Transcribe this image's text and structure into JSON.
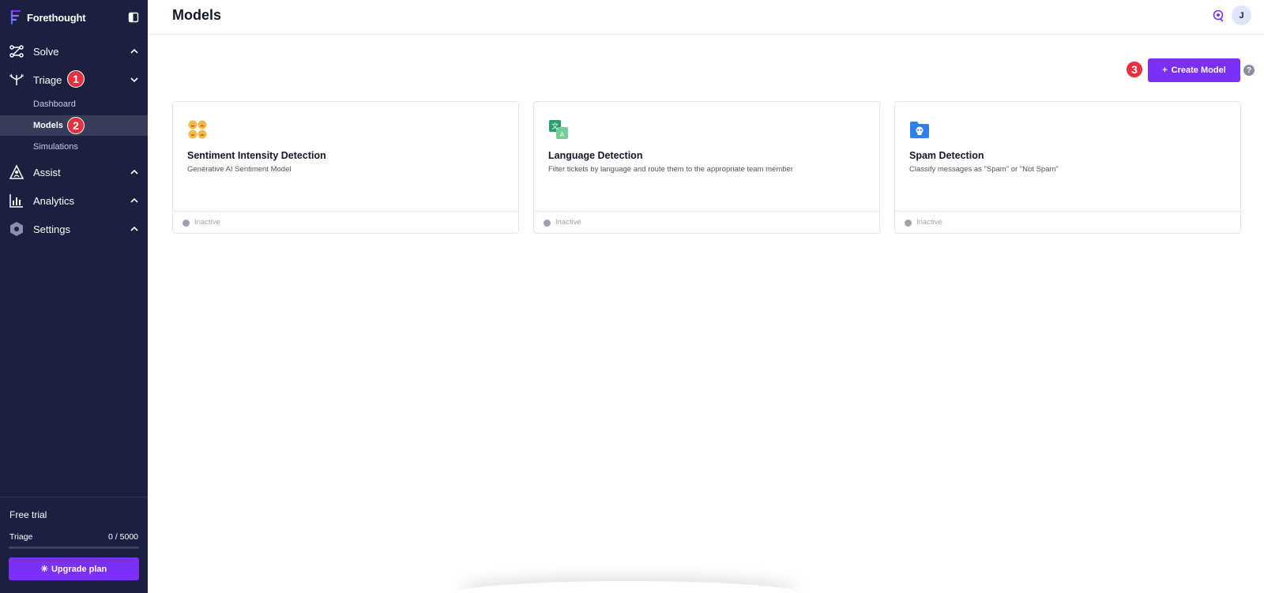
{
  "app": {
    "brand": "Forethought"
  },
  "sidebar": {
    "nav": [
      {
        "label": "Solve"
      },
      {
        "label": "Triage"
      },
      {
        "label": "Assist"
      },
      {
        "label": "Analytics"
      },
      {
        "label": "Settings"
      }
    ],
    "triage_sub": [
      {
        "label": "Dashboard"
      },
      {
        "label": "Models"
      },
      {
        "label": "Simulations"
      }
    ],
    "trial": {
      "title": "Free trial",
      "usage_label": "Triage",
      "usage_value": "0 / 5000",
      "usage_fraction": 0,
      "upgrade_label": "Upgrade plan"
    }
  },
  "markers": [
    "1",
    "2",
    "3"
  ],
  "header": {
    "title": "Models",
    "avatar_initial": "J"
  },
  "actions": {
    "create_label": "Create Model",
    "help_glyph": "?"
  },
  "cards": [
    {
      "title": "Sentiment Intensity Detection",
      "description": "Generative AI Sentiment Model",
      "status": "Inactive",
      "icon": "emoji-faces-icon"
    },
    {
      "title": "Language Detection",
      "description": "Filter tickets by language and route them to the appropriate team member",
      "status": "Inactive",
      "icon": "translate-icon"
    },
    {
      "title": "Spam Detection",
      "description": "Classify messages as \"Spam\" or \"Not Spam\"",
      "status": "Inactive",
      "icon": "spam-folder-icon"
    }
  ],
  "colors": {
    "sidebar_bg": "#1b2040",
    "accent": "#7b2ff7",
    "marker": "#e8313f"
  }
}
